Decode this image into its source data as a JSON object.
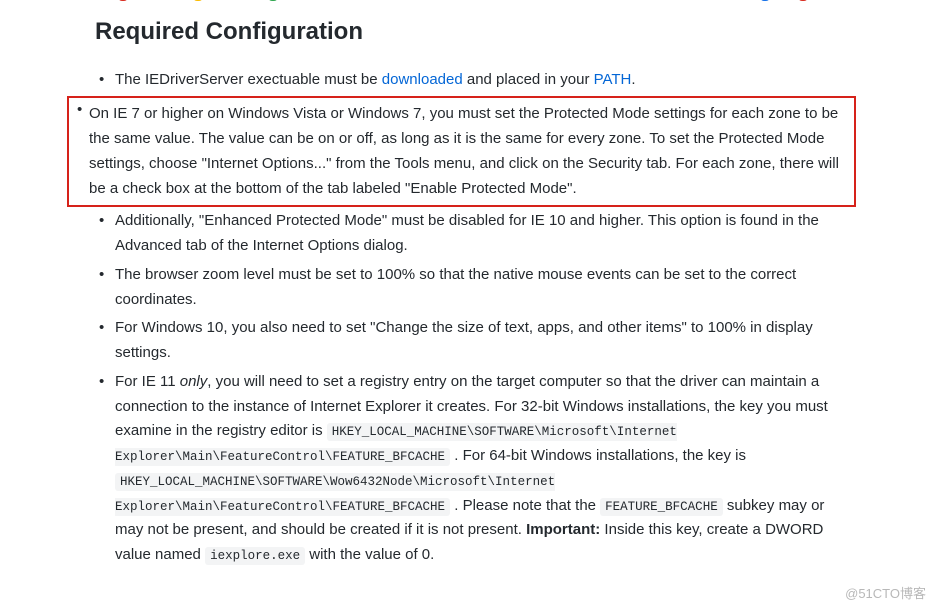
{
  "heading": "Required Configuration",
  "items": [
    {
      "parts": [
        {
          "text": "The IEDriverServer exectuable must be "
        },
        {
          "text": "downloaded",
          "link": true
        },
        {
          "text": " and placed in your "
        },
        {
          "text": "PATH",
          "link": true
        },
        {
          "text": "."
        }
      ]
    },
    {
      "highlighted": true,
      "parts": [
        {
          "text": "On IE 7 or higher on Windows Vista or Windows 7, you must set the Protected Mode settings for each zone to be the same value. The value can be on or off, as long as it is the same for every zone. To set the Protected Mode settings, choose \"Internet Options...\" from the Tools menu, and click on the Security tab. For each zone, there will be a check box at the bottom of the tab labeled \"Enable Protected Mode\"."
        }
      ]
    },
    {
      "parts": [
        {
          "text": "Additionally, \"Enhanced Protected Mode\" must be disabled for IE 10 and higher. This option is found in the Advanced tab of the Internet Options dialog."
        }
      ]
    },
    {
      "parts": [
        {
          "text": "The browser zoom level must be set to 100% so that the native mouse events can be set to the correct coordinates."
        }
      ]
    },
    {
      "parts": [
        {
          "text": "For Windows 10, you also need to set \"Change the size of text, apps, and other items\" to 100% in display settings."
        }
      ]
    },
    {
      "parts": [
        {
          "text": "For IE 11 "
        },
        {
          "text": "only",
          "em": true
        },
        {
          "text": ", you will need to set a registry entry on the target computer so that the driver can maintain a connection to the instance of Internet Explorer it creates. For 32-bit Windows installations, the key you must examine in the registry editor is "
        },
        {
          "text": "HKEY_LOCAL_MACHINE\\SOFTWARE\\Microsoft\\Internet Explorer\\Main\\FeatureControl\\FEATURE_BFCACHE",
          "code": true
        },
        {
          "text": " . For 64-bit Windows installations, the key is "
        },
        {
          "text": "HKEY_LOCAL_MACHINE\\SOFTWARE\\Wow6432Node\\Microsoft\\Internet Explorer\\Main\\FeatureControl\\FEATURE_BFCACHE",
          "code": true
        },
        {
          "text": " . Please note that the "
        },
        {
          "text": "FEATURE_BFCACHE",
          "code": true
        },
        {
          "text": " subkey may or may not be present, and should be created if it is not present. "
        },
        {
          "text": "Important:",
          "strong": true
        },
        {
          "text": " Inside this key, create a DWORD value named "
        },
        {
          "text": "iexplore.exe",
          "code": true
        },
        {
          "text": " with the value of 0."
        }
      ]
    }
  ],
  "watermark": "@51CTO博客"
}
